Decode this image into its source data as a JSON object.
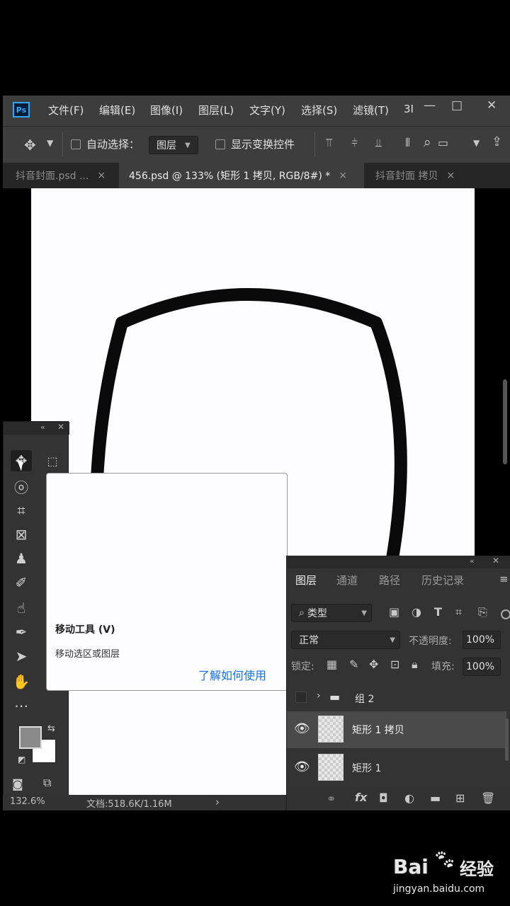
{
  "app": {
    "logo": "Ps"
  },
  "menu": [
    "文件(F)",
    "编辑(E)",
    "图像(I)",
    "图层(L)",
    "文字(Y)",
    "选择(S)",
    "滤镜(T)",
    "3I"
  ],
  "window_controls": {
    "minimize": "—",
    "restore": "□",
    "close": "✕"
  },
  "options": {
    "auto_select_label": "自动选择：",
    "auto_select_value": "图层",
    "show_transform_label": "显示变换控件"
  },
  "tabs": [
    {
      "label": "抖音封面.psd ...",
      "close": "×"
    },
    {
      "label": "456.psd @ 133% (矩形 1 拷贝, RGB/8#) *",
      "close": "×"
    },
    {
      "label": "抖音封面 拷贝",
      "close": "×"
    }
  ],
  "tooltip": {
    "title": "移动工具 (V)",
    "description": "移动选区或图层",
    "link": "了解如何使用"
  },
  "layers_panel": {
    "tabs": [
      "图层",
      "通道",
      "路径",
      "历史记录"
    ],
    "menu_icon": "≡",
    "filter_label": "类型",
    "blend_mode": "正常",
    "opacity_label": "不透明度:",
    "opacity_value": "100%",
    "lock_label": "锁定:",
    "fill_label": "填充:",
    "fill_value": "100%",
    "layers": [
      {
        "name": "组 2",
        "type": "group"
      },
      {
        "name": "矩形 1 拷贝",
        "type": "shape",
        "selected": true
      },
      {
        "name": "矩形 1",
        "type": "shape",
        "selected": false
      }
    ],
    "bottom_icons": [
      "link-icon",
      "fx-icon",
      "mask-icon",
      "adjustment-icon",
      "folder-icon",
      "new-layer-icon",
      "trash-icon"
    ]
  },
  "status": {
    "zoom": "132.6%",
    "doc_info": "文档:518.6K/1.16M",
    "arrow": "›"
  },
  "watermark": {
    "brand": "Bai",
    "brand2": "经验",
    "url": "jingyan.baidu.com"
  },
  "colors": {
    "ui_dark": "#323232",
    "ui_panel": "#3d3d3d",
    "accent_blue": "#1473e6",
    "canvas": "#fdfcfe",
    "shape_stroke": "#0a0a0a"
  }
}
